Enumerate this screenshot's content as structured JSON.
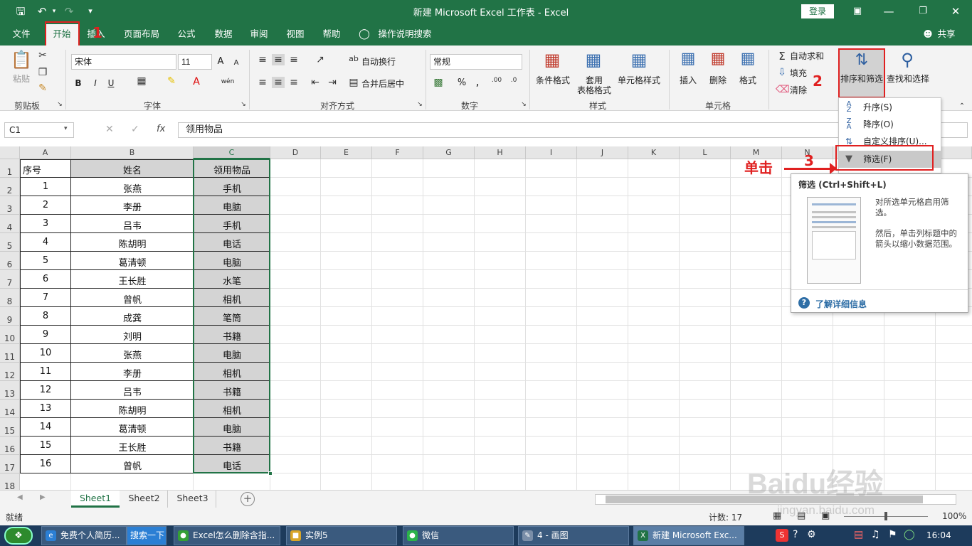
{
  "window": {
    "title": "新建 Microsoft Excel 工作表 - Excel",
    "login": "登录"
  },
  "menu": {
    "tabs": [
      "文件",
      "开始",
      "插入",
      "页面布局",
      "公式",
      "数据",
      "审阅",
      "视图",
      "帮助",
      "操作说明搜索"
    ],
    "share": "共享"
  },
  "ribbon": {
    "clipboard": {
      "paste": "粘贴",
      "group": "剪贴板"
    },
    "font": {
      "name": "宋体",
      "size": "11",
      "bold": "B",
      "italic": "I",
      "underline": "U",
      "grow": "A",
      "shrink": "A",
      "color_a": "A",
      "phonetic": "wén",
      "group": "字体"
    },
    "align": {
      "wrap": "自动换行",
      "merge": "合并后居中",
      "group": "对齐方式"
    },
    "number": {
      "format": "常规",
      "percent": "%",
      "comma": ",",
      "group": "数字"
    },
    "styles": {
      "cond": "条件格式",
      "table1": "套用",
      "table2": "表格格式",
      "cell": "单元格样式",
      "group": "样式"
    },
    "cells": {
      "insert": "插入",
      "delete": "删除",
      "format": "格式",
      "group": "单元格"
    },
    "editing": {
      "autosum": "自动求和",
      "fill": "填充",
      "clear": "清除",
      "sort": "排序和筛选",
      "find": "查找和选择"
    }
  },
  "annotations": {
    "n1": "1",
    "n2": "2",
    "n3": "3",
    "click": "单击"
  },
  "formula": {
    "name": "C1",
    "fx": "fx",
    "content": "领用物品"
  },
  "sheet": {
    "columns": [
      "A",
      "B",
      "C",
      "D",
      "E",
      "F",
      "G",
      "H",
      "I",
      "J",
      "K",
      "L",
      "M",
      "N"
    ],
    "headers": [
      "序号",
      "姓名",
      "领用物品"
    ],
    "rows": [
      [
        "1",
        "张燕",
        "手机"
      ],
      [
        "2",
        "李册",
        "电脑"
      ],
      [
        "3",
        "吕韦",
        "手机"
      ],
      [
        "4",
        "陈胡明",
        "电话"
      ],
      [
        "5",
        "葛清顿",
        "电脑"
      ],
      [
        "6",
        "王长胜",
        "水笔"
      ],
      [
        "7",
        "曾帆",
        "相机"
      ],
      [
        "8",
        "成龚",
        "笔筒"
      ],
      [
        "9",
        "刘明",
        "书籍"
      ],
      [
        "10",
        "张燕",
        "电脑"
      ],
      [
        "11",
        "李册",
        "相机"
      ],
      [
        "12",
        "吕韦",
        "书籍"
      ],
      [
        "13",
        "陈胡明",
        "相机"
      ],
      [
        "14",
        "葛清顿",
        "电脑"
      ],
      [
        "15",
        "王长胜",
        "书籍"
      ],
      [
        "16",
        "曾帆",
        "电话"
      ]
    ]
  },
  "dropdown": {
    "asc": "升序(S)",
    "desc": "降序(O)",
    "custom": "自定义排序(U)...",
    "filter": "筛选(F)"
  },
  "tooltip": {
    "title": "筛选 (Ctrl+Shift+L)",
    "p1": "对所选单元格启用筛选。",
    "p2": "然后，单击列标题中的箭头以缩小数据范围。",
    "more": "了解详细信息"
  },
  "tabs": {
    "s1": "Sheet1",
    "s2": "Sheet2",
    "s3": "Sheet3"
  },
  "status": {
    "ready": "就绪",
    "count": "计数: 17",
    "zoom": "100%"
  },
  "taskbar": {
    "items": [
      "免费个人简历...",
      "搜索一下",
      "Excel怎么删除含指...",
      "实例5",
      "微信",
      "4 - 画图",
      "新建 Microsoft Exc..."
    ],
    "time": "16:04"
  },
  "watermark": "Baidu经验",
  "watermark_url": "jingyan.baidu.com"
}
